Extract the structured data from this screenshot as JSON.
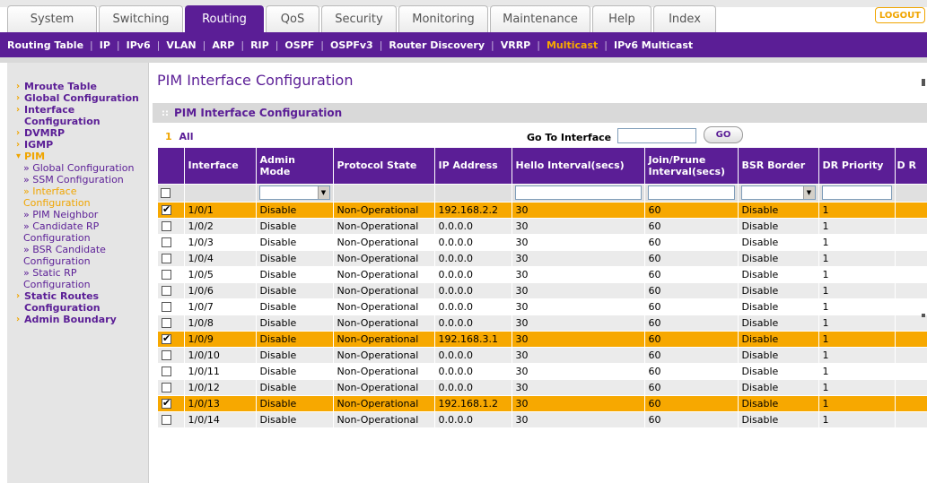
{
  "tabs": [
    {
      "label": "System",
      "active": false
    },
    {
      "label": "Switching",
      "active": false
    },
    {
      "label": "Routing",
      "active": true
    },
    {
      "label": "QoS",
      "active": false
    },
    {
      "label": "Security",
      "active": false
    },
    {
      "label": "Monitoring",
      "active": false
    },
    {
      "label": "Maintenance",
      "active": false
    },
    {
      "label": "Help",
      "active": false
    },
    {
      "label": "Index",
      "active": false
    }
  ],
  "logout_label": "LOGOUT",
  "subnav": [
    {
      "label": "Routing Table",
      "active": false
    },
    {
      "label": "IP",
      "active": false
    },
    {
      "label": "IPv6",
      "active": false
    },
    {
      "label": "VLAN",
      "active": false
    },
    {
      "label": "ARP",
      "active": false
    },
    {
      "label": "RIP",
      "active": false
    },
    {
      "label": "OSPF",
      "active": false
    },
    {
      "label": "OSPFv3",
      "active": false
    },
    {
      "label": "Router Discovery",
      "active": false
    },
    {
      "label": "VRRP",
      "active": false
    },
    {
      "label": "Multicast",
      "active": true
    },
    {
      "label": "IPv6 Multicast",
      "active": false
    }
  ],
  "sidebar": {
    "items": [
      {
        "label": "Mroute Table",
        "type": "top"
      },
      {
        "label": "Global Configuration",
        "type": "top"
      },
      {
        "label": "Interface Configuration",
        "type": "top"
      },
      {
        "label": "DVMRP",
        "type": "top"
      },
      {
        "label": "IGMP",
        "type": "top"
      },
      {
        "label": "PIM",
        "type": "top-open"
      },
      {
        "label": "» Global Configuration",
        "type": "sub"
      },
      {
        "label": "» SSM Configuration",
        "type": "sub"
      },
      {
        "label": "» Interface Configuration",
        "type": "sub-active"
      },
      {
        "label": "» PIM Neighbor",
        "type": "sub"
      },
      {
        "label": "» Candidate RP Configuration",
        "type": "sub"
      },
      {
        "label": "» BSR Candidate Configuration",
        "type": "sub"
      },
      {
        "label": "» Static RP Configuration",
        "type": "sub"
      },
      {
        "label": "Static Routes Configuration",
        "type": "top"
      },
      {
        "label": "Admin Boundary",
        "type": "top"
      }
    ]
  },
  "page": {
    "title": "PIM Interface Configuration",
    "section_title": "PIM Interface Configuration",
    "page_number": "1",
    "page_all": "All",
    "goto_label": "Go To Interface",
    "goto_value": "",
    "go_button": "GO"
  },
  "table": {
    "headers": [
      "Interface",
      "Admin Mode",
      "Protocol State",
      "IP Address",
      "Hello Interval(secs)",
      "Join/Prune Interval(secs)",
      "BSR Border",
      "DR Priority",
      "D R"
    ],
    "rows": [
      {
        "checked": true,
        "interface": "1/0/1",
        "admin_mode": "Disable",
        "protocol_state": "Non-Operational",
        "ip": "192.168.2.2",
        "hello": "30",
        "join_prune": "60",
        "bsr_border": "Disable",
        "dr_priority": "1"
      },
      {
        "checked": false,
        "interface": "1/0/2",
        "admin_mode": "Disable",
        "protocol_state": "Non-Operational",
        "ip": "0.0.0.0",
        "hello": "30",
        "join_prune": "60",
        "bsr_border": "Disable",
        "dr_priority": "1"
      },
      {
        "checked": false,
        "interface": "1/0/3",
        "admin_mode": "Disable",
        "protocol_state": "Non-Operational",
        "ip": "0.0.0.0",
        "hello": "30",
        "join_prune": "60",
        "bsr_border": "Disable",
        "dr_priority": "1"
      },
      {
        "checked": false,
        "interface": "1/0/4",
        "admin_mode": "Disable",
        "protocol_state": "Non-Operational",
        "ip": "0.0.0.0",
        "hello": "30",
        "join_prune": "60",
        "bsr_border": "Disable",
        "dr_priority": "1"
      },
      {
        "checked": false,
        "interface": "1/0/5",
        "admin_mode": "Disable",
        "protocol_state": "Non-Operational",
        "ip": "0.0.0.0",
        "hello": "30",
        "join_prune": "60",
        "bsr_border": "Disable",
        "dr_priority": "1"
      },
      {
        "checked": false,
        "interface": "1/0/6",
        "admin_mode": "Disable",
        "protocol_state": "Non-Operational",
        "ip": "0.0.0.0",
        "hello": "30",
        "join_prune": "60",
        "bsr_border": "Disable",
        "dr_priority": "1"
      },
      {
        "checked": false,
        "interface": "1/0/7",
        "admin_mode": "Disable",
        "protocol_state": "Non-Operational",
        "ip": "0.0.0.0",
        "hello": "30",
        "join_prune": "60",
        "bsr_border": "Disable",
        "dr_priority": "1"
      },
      {
        "checked": false,
        "interface": "1/0/8",
        "admin_mode": "Disable",
        "protocol_state": "Non-Operational",
        "ip": "0.0.0.0",
        "hello": "30",
        "join_prune": "60",
        "bsr_border": "Disable",
        "dr_priority": "1"
      },
      {
        "checked": true,
        "interface": "1/0/9",
        "admin_mode": "Disable",
        "protocol_state": "Non-Operational",
        "ip": "192.168.3.1",
        "hello": "30",
        "join_prune": "60",
        "bsr_border": "Disable",
        "dr_priority": "1"
      },
      {
        "checked": false,
        "interface": "1/0/10",
        "admin_mode": "Disable",
        "protocol_state": "Non-Operational",
        "ip": "0.0.0.0",
        "hello": "30",
        "join_prune": "60",
        "bsr_border": "Disable",
        "dr_priority": "1"
      },
      {
        "checked": false,
        "interface": "1/0/11",
        "admin_mode": "Disable",
        "protocol_state": "Non-Operational",
        "ip": "0.0.0.0",
        "hello": "30",
        "join_prune": "60",
        "bsr_border": "Disable",
        "dr_priority": "1"
      },
      {
        "checked": false,
        "interface": "1/0/12",
        "admin_mode": "Disable",
        "protocol_state": "Non-Operational",
        "ip": "0.0.0.0",
        "hello": "30",
        "join_prune": "60",
        "bsr_border": "Disable",
        "dr_priority": "1"
      },
      {
        "checked": true,
        "interface": "1/0/13",
        "admin_mode": "Disable",
        "protocol_state": "Non-Operational",
        "ip": "192.168.1.2",
        "hello": "30",
        "join_prune": "60",
        "bsr_border": "Disable",
        "dr_priority": "1"
      },
      {
        "checked": false,
        "interface": "1/0/14",
        "admin_mode": "Disable",
        "protocol_state": "Non-Operational",
        "ip": "0.0.0.0",
        "hello": "30",
        "join_prune": "60",
        "bsr_border": "Disable",
        "dr_priority": "1"
      }
    ]
  },
  "colors": {
    "brand_purple": "#5b1e96",
    "accent_orange": "#f7a800",
    "row_alt": "#ebebeb"
  }
}
